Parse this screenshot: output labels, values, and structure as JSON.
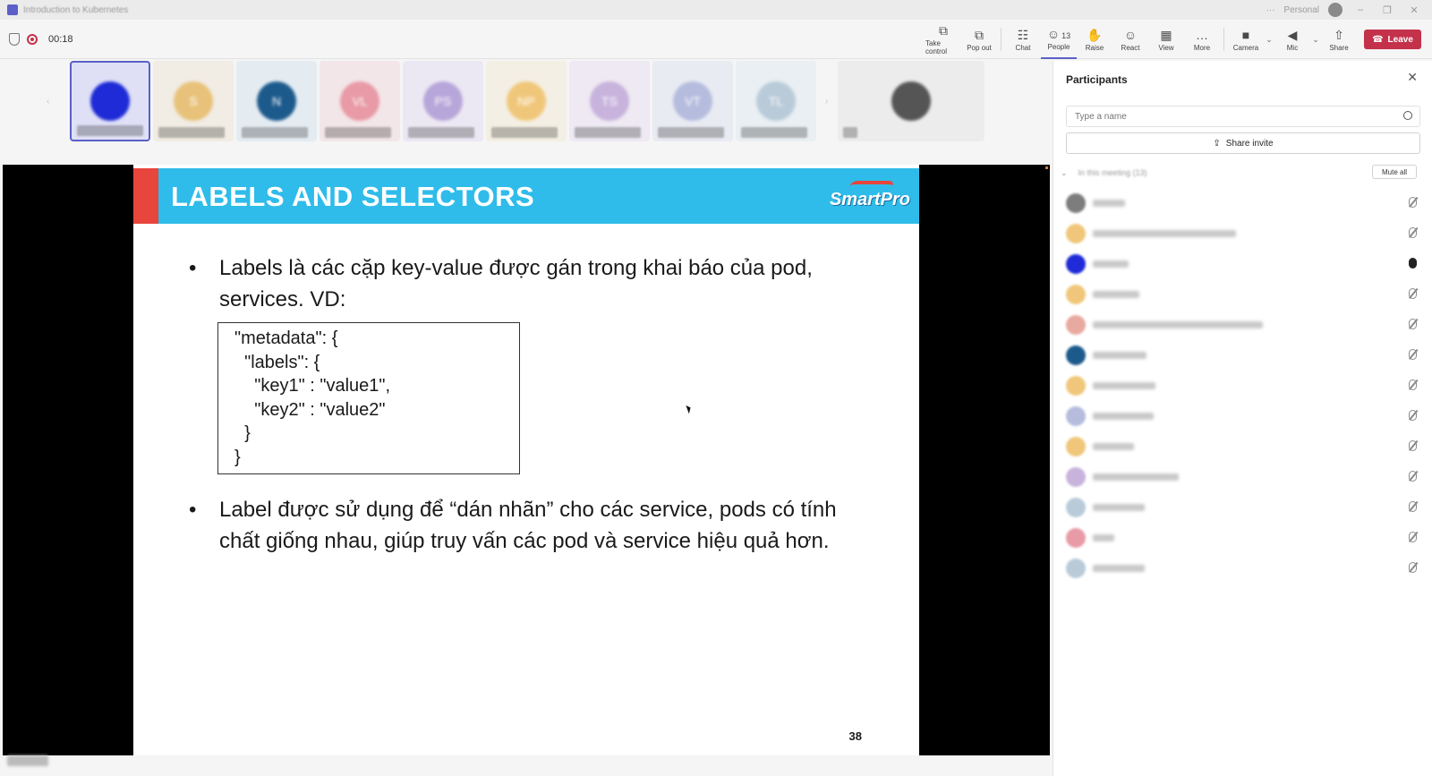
{
  "window": {
    "title": "Introduction to Kubernetes",
    "account": "Personal"
  },
  "meeting": {
    "timer": "00:18"
  },
  "toolbar": [
    {
      "id": "take-control",
      "label": "Take control",
      "icon": "⧉"
    },
    {
      "id": "pop-out",
      "label": "Pop out",
      "icon": "⧉"
    },
    {
      "id": "chat",
      "label": "Chat",
      "icon": "☷"
    },
    {
      "id": "people",
      "label": "People",
      "icon": "☺",
      "badge": "13"
    },
    {
      "id": "raise",
      "label": "Raise",
      "icon": "✋"
    },
    {
      "id": "react",
      "label": "React",
      "icon": "☺"
    },
    {
      "id": "view",
      "label": "View",
      "icon": "▦"
    },
    {
      "id": "more",
      "label": "More",
      "icon": "…"
    },
    {
      "id": "camera",
      "label": "Camera",
      "icon": "■"
    },
    {
      "id": "mic",
      "label": "Mic",
      "icon": "◀"
    },
    {
      "id": "share",
      "label": "Share",
      "icon": "⇧"
    }
  ],
  "leave_label": "Leave",
  "video_strip": [
    {
      "initials": "",
      "color": "#1e2bd6",
      "bg": "#dfe0f6"
    },
    {
      "initials": "S",
      "color": "#e8c27a",
      "bg": "#f1ece4"
    },
    {
      "initials": "N",
      "color": "#1d5a8c",
      "bg": "#e4ecf2"
    },
    {
      "initials": "VL",
      "color": "#e89aa6",
      "bg": "#f3e6e8"
    },
    {
      "initials": "PS",
      "color": "#b7a6d9",
      "bg": "#ece8f3"
    },
    {
      "initials": "NP",
      "color": "#f0c77a",
      "bg": "#f4efe4"
    },
    {
      "initials": "TS",
      "color": "#c7b3dc",
      "bg": "#eee9f2"
    },
    {
      "initials": "VT",
      "color": "#b5bcdd",
      "bg": "#e9ebf3"
    },
    {
      "initials": "TL",
      "color": "#b9cbd9",
      "bg": "#e9eff3"
    }
  ],
  "slide": {
    "title": "LABELS AND SELECTORS",
    "logo": "SmartPro",
    "bullet1": "Labels là các cặp key-value được gán trong khai báo của pod, services. VD:",
    "code": "\"metadata\": {\n  \"labels\": {\n    \"key1\" : \"value1\",\n    \"key2\" : \"value2\"\n  }\n}",
    "bullet2": "Label được sử dụng để “dán nhãn” cho các service, pods có tính chất giống nhau, giúp truy vấn các pod và service hiệu quả hơn.",
    "page_number": "38"
  },
  "participants": {
    "title": "Participants",
    "search_placeholder": "Type a name",
    "share_invite": "Share invite",
    "section_label": "In this meeting (13)",
    "mute_all": "Mute all",
    "list": [
      {
        "color": "#7d7d7d",
        "mic": "off",
        "w": 36
      },
      {
        "color": "#f0c77a",
        "mic": "off",
        "w": 160
      },
      {
        "color": "#1e2bd6",
        "mic": "on",
        "w": 40
      },
      {
        "color": "#f0c77a",
        "mic": "off",
        "w": 52
      },
      {
        "color": "#e8a9a0",
        "mic": "off",
        "w": 190
      },
      {
        "color": "#1d5a8c",
        "mic": "off",
        "w": 60
      },
      {
        "color": "#f0c77a",
        "mic": "off",
        "w": 70
      },
      {
        "color": "#b5bcdd",
        "mic": "off",
        "w": 68
      },
      {
        "color": "#f0c77a",
        "mic": "off",
        "w": 46
      },
      {
        "color": "#c7b3dc",
        "mic": "off",
        "w": 96
      },
      {
        "color": "#b9cbd9",
        "mic": "off",
        "w": 58
      },
      {
        "color": "#e89aa6",
        "mic": "off",
        "w": 24
      },
      {
        "color": "#b9cbd9",
        "mic": "off",
        "w": 58
      }
    ]
  }
}
